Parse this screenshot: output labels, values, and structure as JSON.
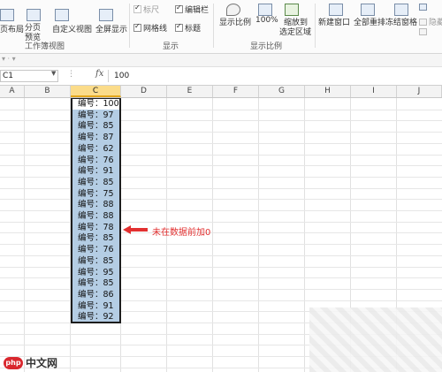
{
  "ribbon": {
    "view_group": {
      "btn_page_layout": "页布局",
      "btn_pagebreak_line1": "分页",
      "btn_pagebreak_line2": "预览",
      "btn_custom_view": "自定义视图",
      "btn_full_screen": "全屏显示",
      "label": "工作簿视图"
    },
    "show_group": {
      "ruler": "标尺",
      "formula_bar": "编辑栏",
      "gridlines": "网格线",
      "headings": "标题",
      "label": "显示"
    },
    "zoom_group": {
      "zoom": "显示比例",
      "hundred": "100%",
      "zoom_selection_line1": "缩放到",
      "zoom_selection_line2": "选定区域",
      "label": "显示比例"
    },
    "window_group": {
      "new_window": "新建窗口",
      "arrange_all": "全部重排",
      "freeze_panes": "冻结窗格",
      "hide": "隐藏"
    }
  },
  "formula_bar": {
    "name_box": "C1",
    "fx_label": "fx",
    "value": "100"
  },
  "columns": [
    "A",
    "B",
    "C",
    "D",
    "E",
    "F",
    "G",
    "H",
    "I",
    "J"
  ],
  "cells": [
    "编号：100",
    "编号：97",
    "编号：85",
    "编号：87",
    "编号：62",
    "编号：76",
    "编号：91",
    "编号：85",
    "编号：75",
    "编号：88",
    "编号：88",
    "编号：78",
    "编号：85",
    "编号：76",
    "编号：85",
    "编号：95",
    "编号：85",
    "编号：86",
    "编号：91",
    "编号：92"
  ],
  "annotation": {
    "text": "未在数据前加0",
    "color": "#e23030"
  },
  "watermark": {
    "logo": "php",
    "text": "中文网"
  },
  "colors": {
    "selection_fill": "#b4cde4",
    "selected_header": "#fbdc8a"
  }
}
